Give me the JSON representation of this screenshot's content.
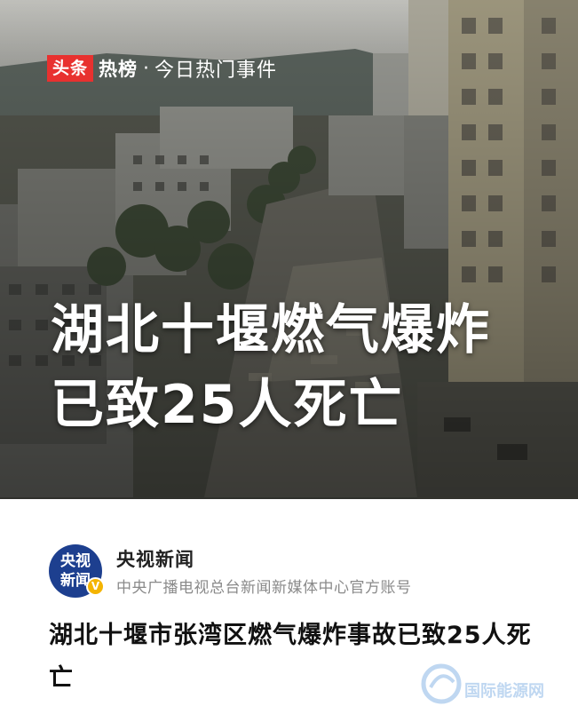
{
  "banner": {
    "logo_label": "头条",
    "hot_label": "热榜",
    "separator": "·",
    "subtitle": "今日热门事件"
  },
  "headline": {
    "line1": "湖北十堰燃气爆炸",
    "line2": "已致25人死亡"
  },
  "source": {
    "avatar_line1": "央视",
    "avatar_line2": "新闻",
    "verified_badge": "V",
    "account_name": "央视新闻",
    "account_description": "中央广播电视总台新闻新媒体中心官方账号"
  },
  "article": {
    "title": "湖北十堰市张湾区燃气爆炸事故已致25人死亡"
  },
  "watermark": {
    "text": "国际能源网"
  },
  "colors": {
    "brand_red": "#e8312f",
    "avatar_blue": "#1d3f8f",
    "verified_yellow": "#f4b400",
    "description_gray": "#8a8a8a"
  }
}
